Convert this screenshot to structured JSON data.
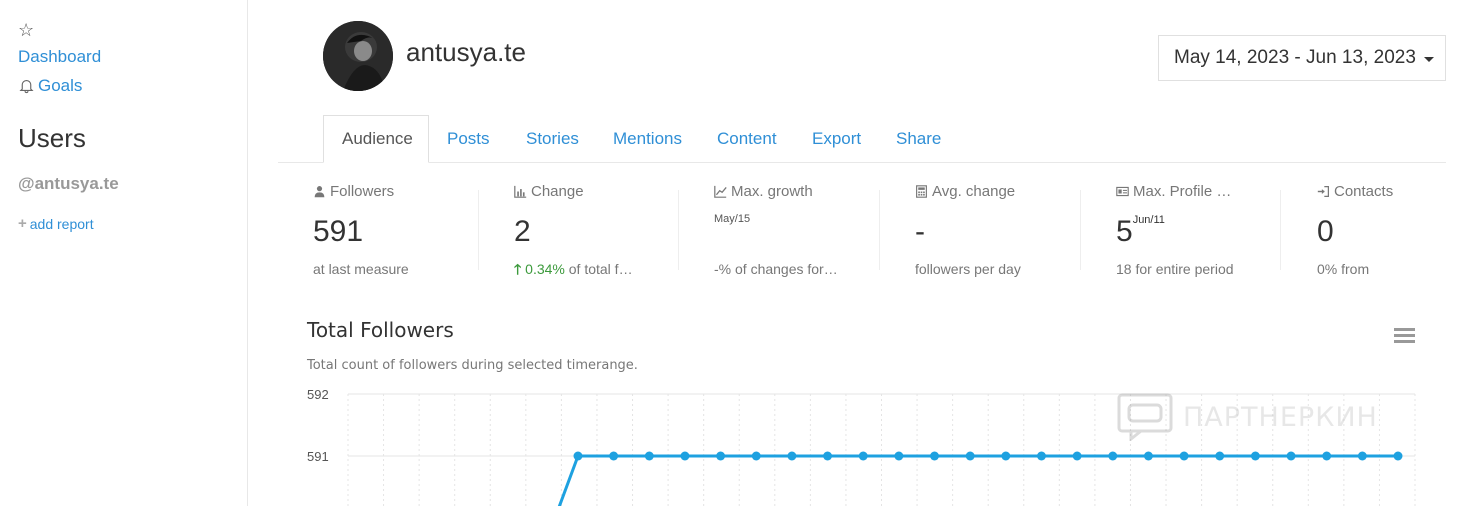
{
  "sidebar": {
    "dashboard_label": "Dashboard",
    "goals_label": "Goals",
    "users_heading": "Users",
    "handle": "@antusya.te",
    "add_report_label": "add report"
  },
  "profile": {
    "username": "antusya.te"
  },
  "date_range": "May 14, 2023 - Jun 13, 2023",
  "tabs": [
    {
      "label": "Audience"
    },
    {
      "label": "Posts"
    },
    {
      "label": "Stories"
    },
    {
      "label": "Mentions"
    },
    {
      "label": "Content"
    },
    {
      "label": "Export"
    },
    {
      "label": "Share"
    }
  ],
  "stats": {
    "followers": {
      "label": "Followers",
      "value": "591",
      "foot": "at last measure"
    },
    "change": {
      "label": "Change",
      "value": "2",
      "foot_pct": "0.34%",
      "foot_rest": "of total f…"
    },
    "max_growth": {
      "label": "Max. growth",
      "date": "May/15",
      "value": "",
      "foot": "-% of changes for…"
    },
    "avg_change": {
      "label": "Avg. change",
      "value": "-",
      "foot": "followers per day"
    },
    "max_profile": {
      "label": "Max. Profile …",
      "value": "5",
      "sup": "Jun/11",
      "foot": "18 for entire period"
    },
    "contacts": {
      "label": "Contacts",
      "value": "0",
      "foot": "0% from"
    }
  },
  "chart": {
    "title": "Total Followers",
    "subtitle": "Total count of followers during selected timerange."
  },
  "watermark_text": "ПАРТНЕРКИН",
  "chart_data": {
    "type": "line",
    "title": "Total Followers",
    "y_tick_labels": [
      "592",
      "591"
    ],
    "ylim": [
      590,
      592
    ],
    "series": [
      {
        "values": [
          590,
          591,
          591,
          591,
          591,
          591,
          591,
          591,
          591,
          591,
          591,
          591,
          591,
          591,
          591,
          591,
          591,
          591,
          591,
          591,
          591,
          591,
          591,
          591,
          591
        ]
      }
    ],
    "color": "#1ea1e0",
    "grid": true
  }
}
